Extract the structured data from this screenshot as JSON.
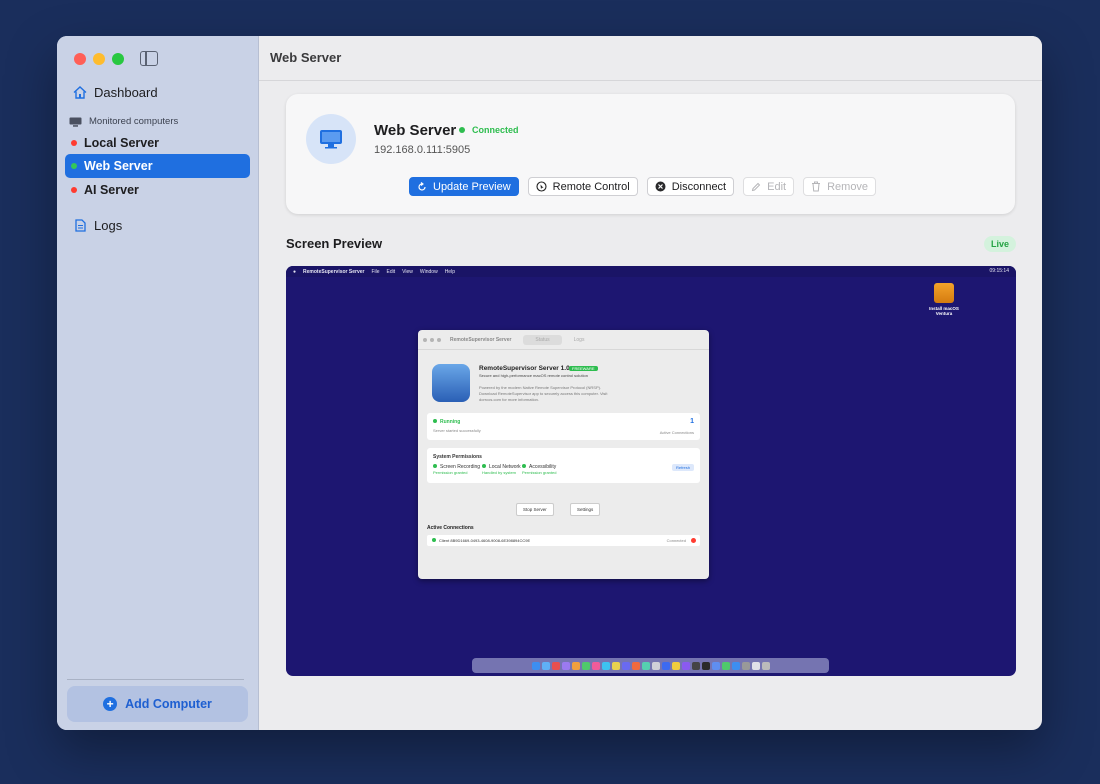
{
  "sidebar": {
    "dashboard_label": "Dashboard",
    "section_label": "Monitored computers",
    "servers": [
      {
        "name": "Local Server",
        "status_color": "#ff3b30",
        "active": false
      },
      {
        "name": "Web Server",
        "status_color": "#34c759",
        "active": true
      },
      {
        "name": "AI Server",
        "status_color": "#ff3b30",
        "active": false
      }
    ],
    "logs_label": "Logs",
    "add_label": "Add Computer"
  },
  "header": {
    "title": "Web Server"
  },
  "card": {
    "title": "Web Server",
    "status": "Connected",
    "address": "192.168.0.111:5905",
    "buttons": {
      "update": "Update Preview",
      "remote": "Remote Control",
      "disconnect": "Disconnect",
      "edit": "Edit",
      "remove": "Remove"
    }
  },
  "preview": {
    "title": "Screen Preview",
    "badge": "Live",
    "menubar": {
      "app": "RemoteSupervisor Server",
      "menus": [
        "File",
        "Edit",
        "View",
        "Window",
        "Help"
      ],
      "clock": "09:15:14"
    },
    "desktop_icon_label": "Install macOS Ventura",
    "inner": {
      "title": "RemoteSupervisor Server",
      "tab_status": "Status",
      "tab_logs": "Logs",
      "app_name": "RemoteSupervisor Server 1.0",
      "app_badge": "FREEWARE",
      "app_desc": "Secure and high-performance macOS remote control solution",
      "app_long": "Powered by the modern Native Remote Supervisor Protocol (NRSP). Download RemoteSupervisor app to securely access this computer. Visit dorrcos.com for more information.",
      "running": "Running",
      "running_sub": "Server started successfully",
      "connections_count": "1",
      "connections_label": "Active Connections",
      "perm_title": "System Permissions",
      "perms": [
        {
          "name": "Screen Recording",
          "state": "Permission granted"
        },
        {
          "name": "Local Network",
          "state": "Handled by system"
        },
        {
          "name": "Accessibility",
          "state": "Permission granted"
        }
      ],
      "refresh": "Refresh",
      "stop": "Stop Server",
      "settings": "Settings",
      "active_title": "Active Connections",
      "client": "Client 8B9D1669-0493-4608-9008-6E398894CC9E",
      "client_state": "Connected"
    }
  },
  "colors": {
    "accent": "#1f6fe0",
    "green": "#34c759",
    "red": "#ff3b30"
  }
}
